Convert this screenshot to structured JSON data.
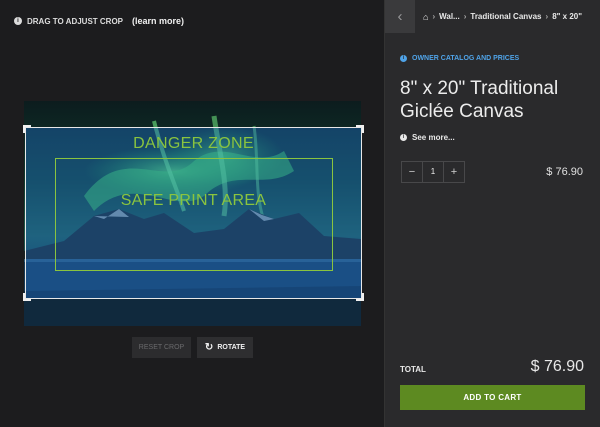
{
  "editor": {
    "hint": "DRAG TO ADJUST CROP",
    "learn_more": "(learn more)",
    "danger_label": "DANGER ZONE",
    "safe_label": "SAFE PRINT AREA",
    "reset_label": "RESET CROP",
    "rotate_label": "ROTATE"
  },
  "breadcrumb": {
    "items": [
      "Wal...",
      "Traditional Canvas",
      "8\" x 20\""
    ]
  },
  "product": {
    "catalog_link": "OWNER CATALOG AND PRICES",
    "title": "8\" x 20\" Traditional Giclée Canvas",
    "see_more": "See more...",
    "quantity": "1",
    "unit_price": "$ 76.90",
    "total_label": "TOTAL",
    "total_value": "$ 76.90",
    "add_to_cart": "ADD TO CART"
  },
  "colors": {
    "accent_green": "#5d8a21",
    "guide_green": "#8ac43f",
    "link_blue": "#4fa3e8"
  },
  "icons": [
    "info-icon",
    "rotate-icon",
    "back-chevron-icon",
    "home-icon",
    "minus-icon",
    "plus-icon",
    "crop-corner-handle"
  ]
}
